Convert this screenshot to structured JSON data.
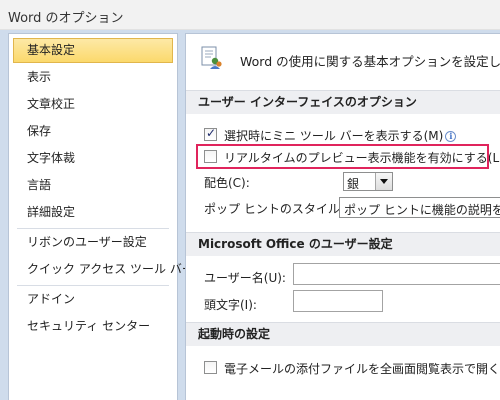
{
  "window": {
    "title": "Word のオプション"
  },
  "sidebar": {
    "items": [
      {
        "label": "基本設定",
        "selected": true
      },
      {
        "label": "表示"
      },
      {
        "label": "文章校正"
      },
      {
        "label": "保存"
      },
      {
        "label": "文字体裁"
      },
      {
        "label": "言語"
      },
      {
        "label": "詳細設定"
      },
      {
        "label": "リボンのユーザー設定"
      },
      {
        "label": "クイック アクセス ツール バー"
      },
      {
        "label": "アドイン"
      },
      {
        "label": "セキュリティ センター"
      }
    ]
  },
  "content": {
    "intro": "Word の使用に関する基本オプションを設定します。",
    "ui_section": {
      "heading": "ユーザー インターフェイスのオプション",
      "mini_toolbar": {
        "label": "選択時にミニ ツール バーを表示する(M)",
        "checked": true
      },
      "live_preview": {
        "label": "リアルタイムのプレビュー表示機能を有効にする(L)",
        "checked": false
      },
      "color_scheme": {
        "label": "配色(C):",
        "value": "銀"
      },
      "tooltip_style": {
        "label": "ポップ ヒントのスタイル(R):",
        "value": "ポップ ヒントに機能の説明を表示する"
      }
    },
    "user_section": {
      "heading": "Microsoft Office のユーザー設定",
      "username": {
        "label": "ユーザー名(U):",
        "value": ""
      },
      "initials": {
        "label": "頭文字(I):",
        "value": ""
      }
    },
    "startup_section": {
      "heading": "起動時の設定",
      "open_attachments": {
        "label": "電子メールの添付ファイルを全画面閲覧表示で開く(F)",
        "checked": false
      }
    }
  },
  "colors": {
    "highlight_border": "#e0245c",
    "selected_item": "#fbd96c",
    "frame": "#cfdcec"
  }
}
